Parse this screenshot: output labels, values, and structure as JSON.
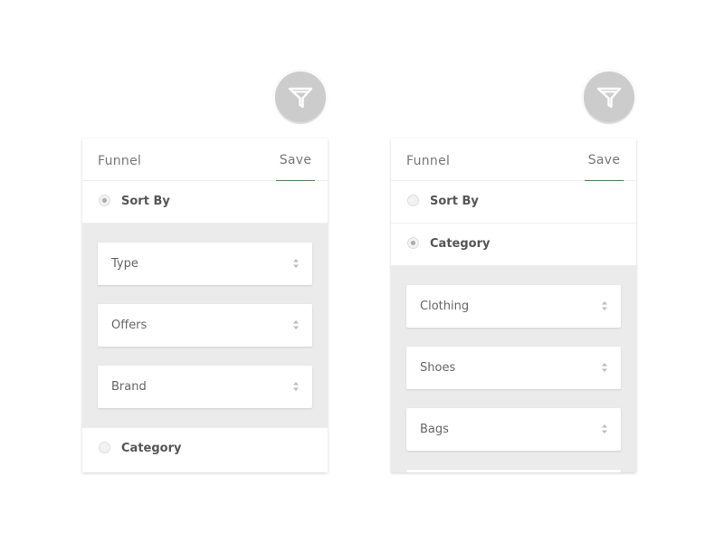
{
  "left_panel": {
    "title": "Funnel",
    "save_label": "Save",
    "options": [
      {
        "label": "Sort By",
        "checked": true
      },
      {
        "label": "Category",
        "checked": false
      }
    ],
    "selects": [
      {
        "label": "Type"
      },
      {
        "label": "Offers"
      },
      {
        "label": "Brand"
      }
    ]
  },
  "right_panel": {
    "title": "Funnel",
    "save_label": "Save",
    "options": [
      {
        "label": "Sort By",
        "checked": false
      },
      {
        "label": "Category",
        "checked": true
      }
    ],
    "selects": [
      {
        "label": "Clothing"
      },
      {
        "label": "Shoes"
      },
      {
        "label": "Bags"
      }
    ]
  },
  "icons": {
    "filter": "funnel-icon",
    "select_arrows": "updown-arrows-icon"
  },
  "colors": {
    "accent_underline": "#3e9b4a",
    "filter_button": "#cccccc",
    "sub_area_bg": "#ebebeb"
  }
}
